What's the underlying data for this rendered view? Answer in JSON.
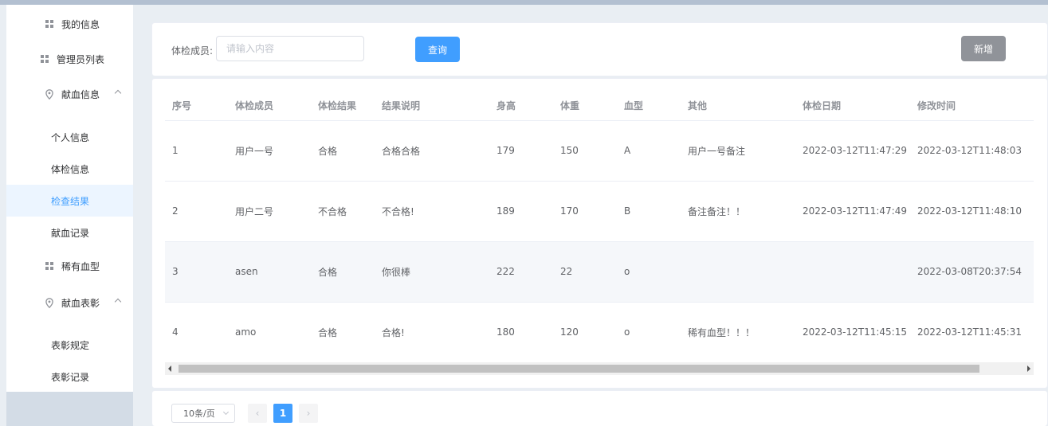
{
  "sidebar": {
    "items": [
      {
        "label": "我的信息",
        "icon": "grid-icon"
      },
      {
        "label": "管理员列表",
        "icon": "grid-icon"
      },
      {
        "label": "献血信息",
        "icon": "location-icon"
      },
      {
        "label": "稀有血型",
        "icon": "grid-icon"
      },
      {
        "label": "献血表彰",
        "icon": "location-icon"
      }
    ],
    "donation_sub": [
      "个人信息",
      "体检信息",
      "检查结果",
      "献血记录"
    ],
    "commend_sub": [
      "表彰规定",
      "表彰记录"
    ],
    "active": "检查结果"
  },
  "search": {
    "label": "体检成员:",
    "placeholder": "请输入内容",
    "query_label": "查询",
    "add_label": "新增"
  },
  "table": {
    "columns": [
      "序号",
      "体检成员",
      "体检结果",
      "结果说明",
      "身高",
      "体重",
      "血型",
      "其他",
      "体检日期",
      "修改时间"
    ],
    "rows": [
      [
        "1",
        "用户一号",
        "合格",
        "合格合格",
        "179",
        "150",
        "A",
        "用户一号备注",
        "2022-03-12T11:47:29",
        "2022-03-12T11:48:03"
      ],
      [
        "2",
        "用户二号",
        "不合格",
        "不合格!",
        "189",
        "170",
        "B",
        "备注备注！！",
        "2022-03-12T11:47:49",
        "2022-03-12T11:48:10"
      ],
      [
        "3",
        "asen",
        "合格",
        "你很棒",
        "222",
        "22",
        "o",
        "",
        "",
        "2022-03-08T20:37:54"
      ],
      [
        "4",
        "amo",
        "合格",
        "合格!",
        "180",
        "120",
        "o",
        "稀有血型！！！",
        "2022-03-12T11:45:15",
        "2022-03-12T11:45:31"
      ]
    ]
  },
  "pagination": {
    "page_size": "10条/页",
    "prev": "‹",
    "current": "1",
    "next": "›"
  },
  "colors": {
    "primary": "#409eff",
    "info": "#909399",
    "active_bg": "#ecf5ff"
  }
}
